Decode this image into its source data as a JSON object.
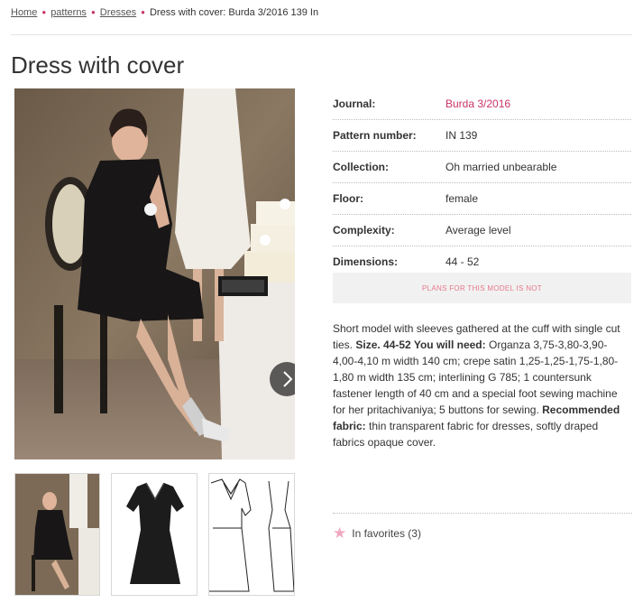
{
  "breadcrumb": {
    "items": [
      "Home",
      "patterns",
      "Dresses"
    ],
    "current": "Dress with cover: Burda 3/2016 139 In"
  },
  "page_title": "Dress with cover",
  "details": {
    "journal": {
      "label": "Journal:",
      "value": "Burda 3/2016"
    },
    "pattern_number": {
      "label": "Pattern number:",
      "value": "IN 139"
    },
    "collection": {
      "label": "Collection:",
      "value": "Oh married unbearable"
    },
    "floor": {
      "label": "Floor:",
      "value": "female"
    },
    "complexity": {
      "label": "Complexity:",
      "value": "Average level"
    },
    "dimensions": {
      "label": "Dimensions:",
      "value": "44 - 52"
    }
  },
  "plans_button": "PLANS FOR THIS MODEL IS NOT",
  "description": {
    "intro": "Short model with sleeves gathered at the cuff with single cut ties.",
    "size_label": "Size. 44-52 You will need:",
    "needs": "Organza 3,75-3,80-3,90-4,00-4,10 m width 140 cm; crepe satin 1,25-1,25-1,75-1,80-1,80 m width 135 cm; interlining G 785; 1 countersunk fastener length of 40 cm and a special foot sewing machine for her pritachivaniya; 5 buttons for sewing.",
    "fabric_label": "Recommended fabric:",
    "fabric": "thin transparent fabric for dresses, softly draped fabrics opaque cover."
  },
  "favorites": {
    "label": "In favorites (3)",
    "icon": "star-icon"
  },
  "colors": {
    "accent": "#c8336a",
    "button_text": "#e57a8b",
    "button_bg": "#f1f1f1"
  }
}
